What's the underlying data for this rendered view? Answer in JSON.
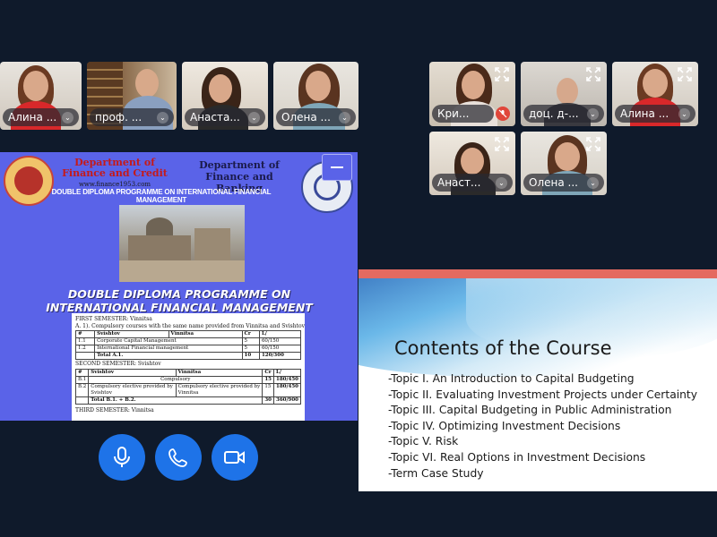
{
  "participants_left": [
    {
      "name": "Алина ..."
    },
    {
      "name": "проф. ..."
    },
    {
      "name": "Анаста..."
    },
    {
      "name": "Олена ..."
    }
  ],
  "participants_right": [
    {
      "name": "Кри..."
    },
    {
      "name": "доц. д-..."
    },
    {
      "name": "Алина ..."
    },
    {
      "name": "Анаст..."
    },
    {
      "name": "Олена ..."
    }
  ],
  "left_slide": {
    "dept_left": "Department of Finance and Credit",
    "dept_left_url": "www.finance1953.com",
    "dept_right": "Department of Finance and Banking",
    "programme_line": "DOUBLE DIPLOMA PROGRAMME ON INTERNATIONAL FINANCIAL MANAGEMENT",
    "big_title_1": "DOUBLE DIPLOMA PROGRAMME ON",
    "big_title_2": "INTERNATIONAL FINANCIAL MANAGEMENT",
    "doc": {
      "first_semester": "FIRST SEMESTER: Vinnitsa",
      "a1": "A. 1). Compulsory courses with the same name provided from Vinnitsa and Svishtov",
      "headers": [
        "#",
        "Svishtov",
        "Vinnitsa",
        "Cr",
        "L/"
      ],
      "rows1": [
        [
          "1.1",
          "Corporate Capital Management",
          "",
          "5",
          "60/150"
        ],
        [
          "1.2",
          "International Financial management",
          "",
          "5",
          "60/150"
        ],
        [
          "",
          "Total A.1.",
          "",
          "10",
          "120/300"
        ]
      ],
      "second_semester": "SECOND SEMESTER: Svishtov",
      "rows2": [
        [
          "B.1",
          "Compulsory",
          "",
          "15",
          "180/450"
        ],
        [
          "B.2",
          "Compulsory elective provided by Svishtov",
          "Compulsory elective provided by Vinnitsa",
          "15",
          "180/450"
        ],
        [
          "",
          "Total B.1. + B.2.",
          "",
          "30",
          "360/900"
        ]
      ],
      "third_semester": "THIRD SEMESTER: Vinnitsa"
    }
  },
  "controls": {
    "mic": "microphone-icon",
    "phone": "phone-icon",
    "camera": "camera-icon"
  },
  "right_slide": {
    "title": "Contents of the Course",
    "topics": [
      "-Topic I. An Introduction to Capital Budgeting",
      "-Topic II. Evaluating Investment Projects under Certainty",
      "-Topic III. Capital Budgeting in Public Administration",
      "-Topic IV. Optimizing Investment Decisions",
      "-Topic V. Risk",
      "-Topic VI. Real Options in Investment Decisions",
      "-Term Case Study"
    ]
  },
  "colors": {
    "background": "#0f1a2b",
    "control_blue": "#1e73e8",
    "slide_blue": "#5a63e8",
    "accent_red": "#e46a60"
  }
}
